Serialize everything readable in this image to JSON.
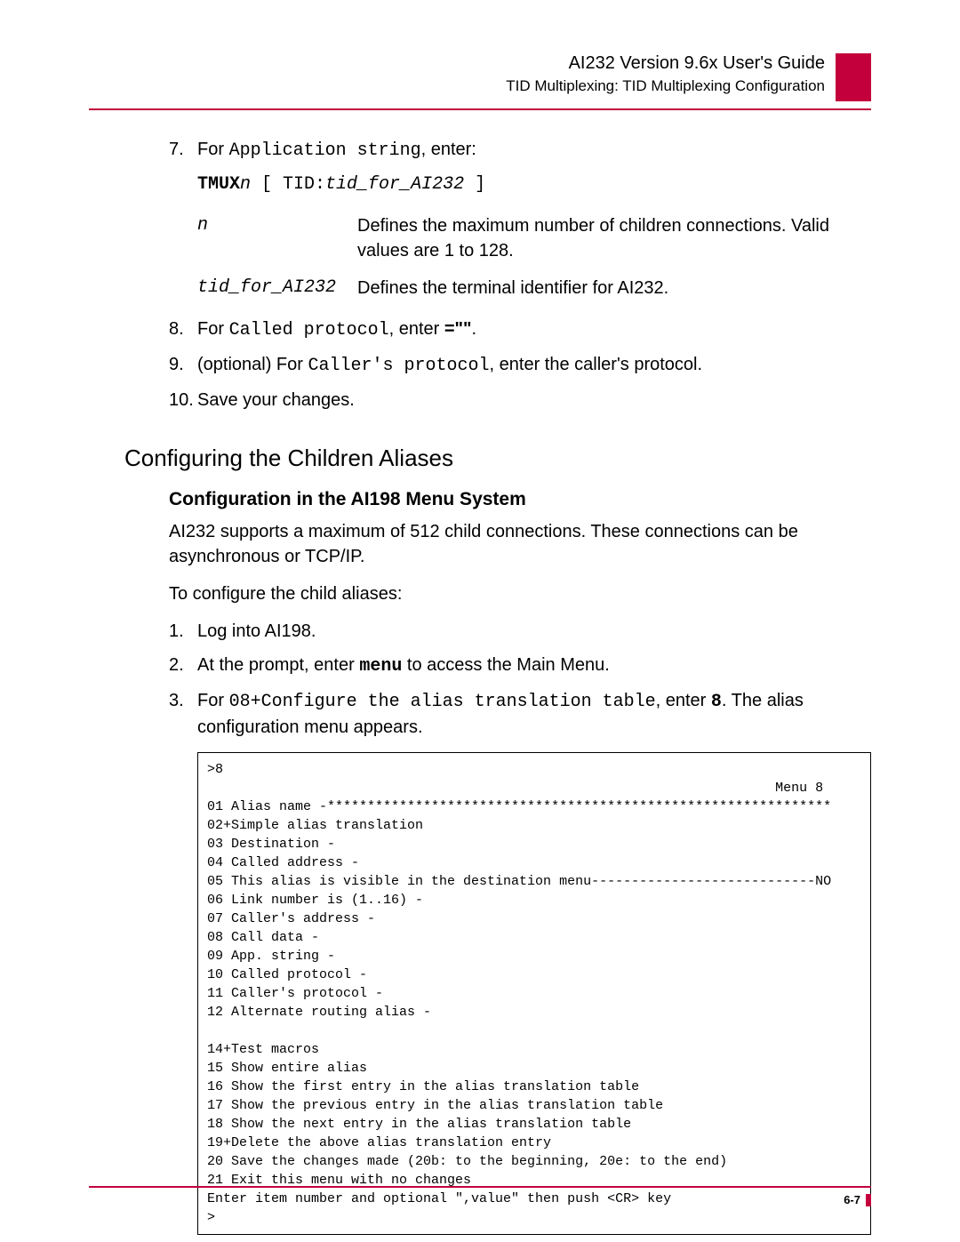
{
  "header": {
    "title": "AI232 Version 9.6x User's Guide",
    "subtitle": "TID Multiplexing: TID Multiplexing Configuration"
  },
  "steps7to10": {
    "s7": {
      "num": "7.",
      "pre": "For ",
      "mono": "Application string",
      "post": ", enter:"
    },
    "cmd": {
      "tmux": "TMUX",
      "n": "n",
      "bracket": " [ TID:",
      "tid": "tid_for_AI232",
      "close": " ]"
    },
    "def_n": {
      "term": "n",
      "body": "Defines the maximum number of children connections. Valid values are 1 to 128."
    },
    "def_tid": {
      "term": "tid_for_AI232",
      "body": "Defines the terminal identifier for AI232."
    },
    "s8": {
      "num": "8.",
      "pre": "For ",
      "mono": "Called protocol",
      "post": ", enter "
    },
    "s8q": "=\"\"",
    "s8end": ".",
    "s9": {
      "num": "9.",
      "pre": "(optional) For ",
      "mono": "Caller's protocol",
      "post": ", enter the caller's protocol."
    },
    "s10": {
      "num": "10.",
      "body": "Save your changes."
    }
  },
  "section": "Configuring the Children Aliases",
  "subsection": "Configuration in the AI198 Menu System",
  "para1": "AI232 supports a maximum of 512 child connections. These connections can be asynchronous or TCP/IP.",
  "para2": "To configure the child aliases:",
  "childSteps": {
    "c1": {
      "num": "1.",
      "body": "Log into AI198."
    },
    "c2": {
      "num": "2.",
      "pre": "At the prompt, enter ",
      "cmd": "menu",
      "post": " to access the Main Menu."
    },
    "c3": {
      "num": "3.",
      "pre": "For ",
      "mono": "08+Configure the alias translation table",
      "mid": ", enter ",
      "cmd": "8",
      "post": ". The alias configuration menu appears."
    }
  },
  "menu": ">8\n                                                                       Menu 8\n01 Alias name -***************************************************************\n02+Simple alias translation\n03 Destination -\n04 Called address -\n05 This alias is visible in the destination menu----------------------------NO\n06 Link number is (1..16) -\n07 Caller's address -\n08 Call data -\n09 App. string -\n10 Called protocol -\n11 Caller's protocol -\n12 Alternate routing alias -\n\n14+Test macros\n15 Show entire alias\n16 Show the first entry in the alias translation table\n17 Show the previous entry in the alias translation table\n18 Show the next entry in the alias translation table\n19+Delete the above alias translation entry\n20 Save the changes made (20b: to the beginning, 20e: to the end)\n21 Exit this menu with no changes\nEnter item number and optional \",value\" then push <CR> key\n>",
  "pagenum": "6-7"
}
